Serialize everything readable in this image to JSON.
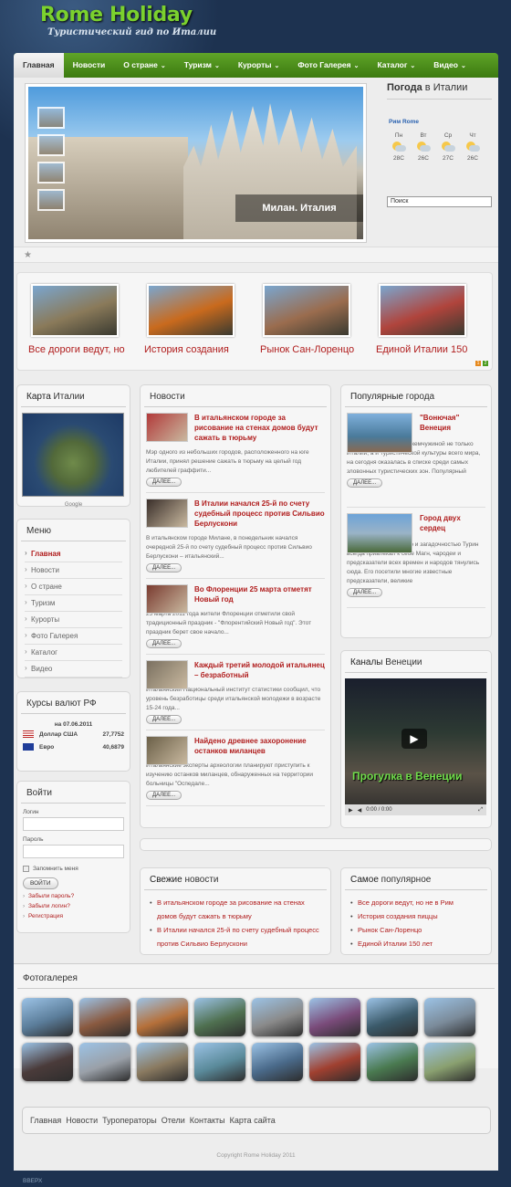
{
  "site": {
    "title": "Rome Holiday",
    "tagline": "Туристический гид по Италии",
    "to_top": "ВВЕРХ",
    "copyright": "Copyright Rome Holiday 2011"
  },
  "nav": [
    {
      "label": "Главная",
      "active": true,
      "dropdown": false
    },
    {
      "label": "Новости",
      "dropdown": false
    },
    {
      "label": "О стране",
      "dropdown": true
    },
    {
      "label": "Туризм",
      "dropdown": true
    },
    {
      "label": "Курорты",
      "dropdown": true
    },
    {
      "label": "Фото Галерея",
      "dropdown": true
    },
    {
      "label": "Каталог",
      "dropdown": true
    },
    {
      "label": "Видео",
      "dropdown": true
    }
  ],
  "slider": {
    "caption": "Милан. Италия"
  },
  "weather": {
    "title_main": "Погода",
    "title_rest": " в Италии",
    "city": "Рим Rome",
    "days": [
      {
        "day": "Пн",
        "temp": "28C",
        "icon": "sun-cloud-icon"
      },
      {
        "day": "Вт",
        "temp": "26C",
        "icon": "rain-cloud-icon"
      },
      {
        "day": "Ср",
        "temp": "27C",
        "icon": "sun-cloud-icon"
      },
      {
        "day": "Чт",
        "temp": "26C",
        "icon": "sun-cloud-icon"
      }
    ]
  },
  "search": {
    "placeholder": "Поиск"
  },
  "featured": [
    {
      "title": "Все дороги ведут, но",
      "color": "#8a7a5a"
    },
    {
      "title": "История создания",
      "color": "#c96a1d"
    },
    {
      "title": "Рынок Сан-Лоренцо",
      "color": "#9a6c4e"
    },
    {
      "title": "Единой Италии 150",
      "color": "#b0443c"
    }
  ],
  "map_box": {
    "title_main": "Карта",
    "title_rest": " Италии",
    "caption": "Google"
  },
  "menu": {
    "title": "Меню",
    "items": [
      "Главная",
      "Новости",
      "О стране",
      "Туризм",
      "Курорты",
      "Фото Галерея",
      "Каталог",
      "Видео"
    ]
  },
  "currency": {
    "title": "Курсы валют РФ",
    "date": "на 07.06.2011",
    "rows": [
      {
        "name": "Доллар США",
        "value": "27,7752"
      },
      {
        "name": "Евро",
        "value": "40,6879"
      }
    ]
  },
  "login": {
    "title": "Войти",
    "login_label": "Логин",
    "password_label": "Пароль",
    "remember": "Запомнить меня",
    "button": "ВОЙТИ",
    "links": [
      "Забыли пароль?",
      "Забыли логин?",
      "Регистрация"
    ]
  },
  "news": {
    "title": "Новости",
    "more": "ДАЛЕЕ...",
    "items": [
      {
        "title": "В итальянском городе за рисование на стенах домов будут сажать в тюрьму",
        "text": "Мэр одного из небольших городов, расположенного на юге Италии, принял решение сажать в тюрьму на целый год любителей граффити...",
        "color": "#b23a3a"
      },
      {
        "title": "В Италии начался 25-й по счету судебный процесс против Сильвио Берлускони",
        "text": "В итальянском городе Милане, в понедельник начался очередной 25-й по счету судебный процесс против Сильвио Берлускони – итальянский...",
        "color": "#3a2f2a"
      },
      {
        "title": "Во Флоренции 25 марта отметят Новый год",
        "text": "25 марта 2011 года жители Флоренции отметили свой традиционный праздник - \"Флорентийский Новый год\". Этот праздник берет свое начало...",
        "color": "#7a3b30"
      },
      {
        "title": "Каждый третий молодой итальянец – безработный",
        "text": "Итальянский Национальный институт статистики сообщил, что уровень безработицы среди итальянской молодежи в возрасте 15-24 года...",
        "color": "#7a7060"
      },
      {
        "title": "Найдено древнее захоронение останков миланцев",
        "text": "Итальянские эксперты археологии планируют приступить к изучению останков миланцев, обнаруженных на территории больницы \"Оспедале...",
        "color": "#6b6048"
      }
    ]
  },
  "popular_cities": {
    "title_main": "Популярные",
    "title_rest": " города",
    "more": "ДАЛЕЕ...",
    "items": [
      {
        "title": "\"Вонючая\" Венеция",
        "text": "Венеция, являющаяся жемчужиной не только Италии, а и туристической культуры всего мира, на сегодня оказалась в списке среди самых зловонных туристических зон. Популярный"
      },
      {
        "title": "Город двух сердец",
        "text": "Своей таинственностью и загадочностью Турин всегда привлекал к себе Магн, чародеи и предсказатели всех времен и народов тянулись сюда. Его посетили многие известные предсказатели, великие"
      }
    ]
  },
  "video": {
    "title_main": "Каналы",
    "title_rest": " Венеции",
    "overlay": "Прогулка в Венеции",
    "time": "0:00 / 0:00"
  },
  "fresh_news": {
    "title_main": "Свежие",
    "title_rest": " новости",
    "items": [
      "В итальянском городе за рисование на стенах домов будут сажать в тюрьму",
      "В Италии начался 25-й по счету судебный процесс против Сильвио Берлускони"
    ]
  },
  "most_popular": {
    "title_main": "Самое",
    "title_rest": " популярное",
    "items": [
      "Все дороги ведут, но не в Рим",
      "История создания пиццы",
      "Рынок Сан-Лоренцо",
      "Единой Италии 150 лет"
    ]
  },
  "gallery": {
    "title": "Фотогалерея",
    "colors": [
      "#5b7d9a",
      "#8a5a40",
      "#b5703a",
      "#4f7050",
      "#8a8a8a",
      "#7a4b7a",
      "#3b5a6a",
      "#7b8b9a",
      "#4a3b3a",
      "#9aa0a8",
      "#8a7a60",
      "#5a8a9a",
      "#4a6a8a",
      "#a04030",
      "#4a7a50",
      "#8aa070"
    ]
  },
  "footer": {
    "links": [
      "Главная",
      "Новости",
      "Туроператоры",
      "Отели",
      "Контакты",
      "Карта сайта"
    ]
  }
}
